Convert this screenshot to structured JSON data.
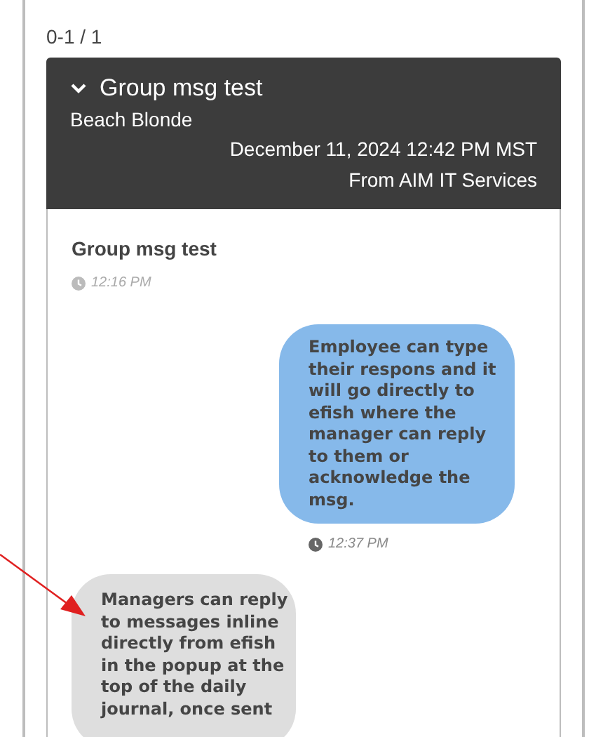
{
  "pager": "0-1 / 1",
  "header": {
    "expanded": true,
    "title": "Group msg test",
    "sender": "Beach Blonde",
    "date": "December 11, 2024 12:42 PM MST",
    "source": "From AIM IT Services"
  },
  "body": {
    "title": "Group msg test",
    "time": "12:16 PM"
  },
  "messages": [
    {
      "kind": "sent",
      "text": "Employee can type their respons and it will go directly to efish where the manager can reply to them or acknowledge the msg.",
      "time": "12:37 PM"
    },
    {
      "kind": "received",
      "text": "Managers can reply to messages inline directly from efish in the popup at the top of the daily journal, once sent"
    }
  ]
}
